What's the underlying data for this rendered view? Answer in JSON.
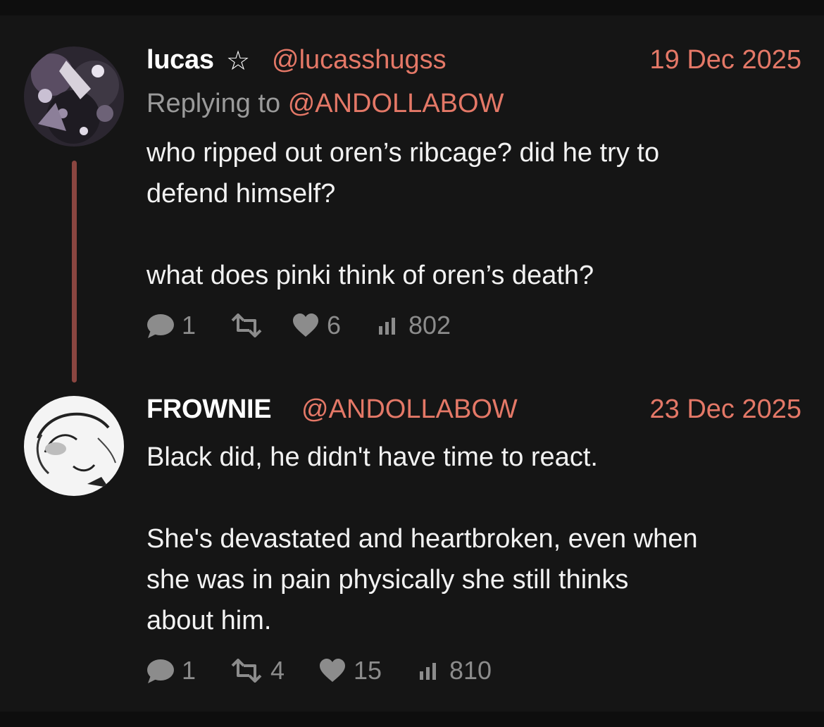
{
  "posts": [
    {
      "display_name": "lucas",
      "badge": "☆",
      "handle": "@lucasshugss",
      "date": "19 Dec 2025",
      "replying_label": "Replying to",
      "replying_to": "@ANDOLLABOW",
      "text": "who ripped out oren’s ribcage? did he try to\ndefend himself?\n\nwhat does pinki think of oren’s death?",
      "replies": "1",
      "reposts": "",
      "likes": "6",
      "views": "802"
    },
    {
      "display_name": "FROWNIE",
      "handle": "@ANDOLLABOW",
      "date": "23 Dec 2025",
      "text": "Black did, he didn't have time to react.\n\nShe's devastated and heartbroken, even when\nshe was in pain physically she still thinks\nabout him.",
      "replies": "1",
      "reposts": "4",
      "likes": "15",
      "views": "810"
    }
  ],
  "colors": {
    "background": "#151515",
    "accent": "#e47867",
    "muted": "#8c8c8c",
    "thread_line": "#8a4540"
  },
  "icons": [
    "reply-icon",
    "repost-icon",
    "like-icon",
    "views-icon"
  ]
}
